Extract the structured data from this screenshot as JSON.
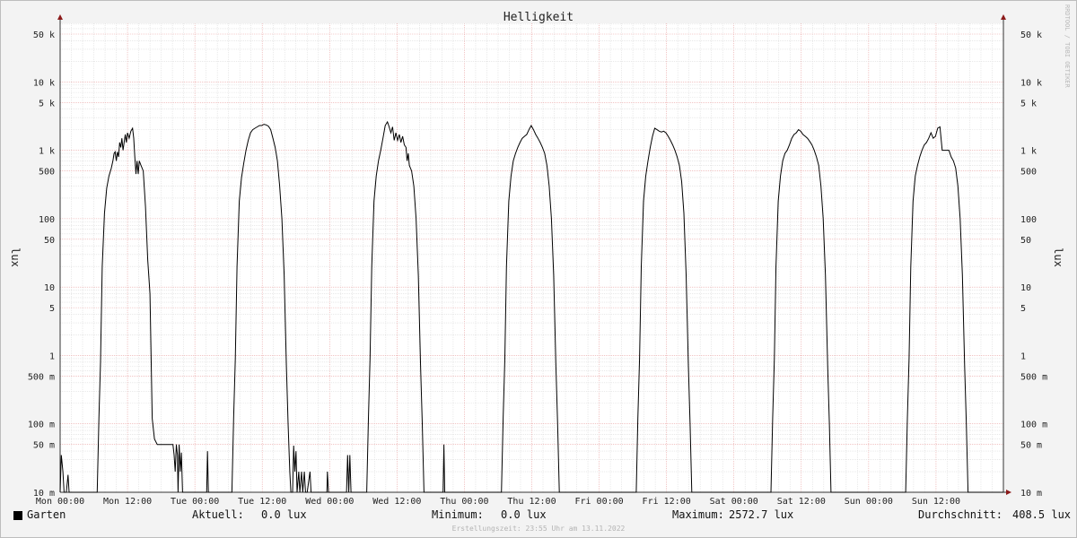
{
  "chart_data": {
    "type": "line",
    "title": "Helligkeit",
    "ylabel": "lux",
    "yscale": "log",
    "ylim": [
      10,
      70000
    ],
    "y_ticks": [
      {
        "value": 10,
        "label": "10 m",
        "unit": 0.001
      },
      {
        "value": 50,
        "label": "50 m",
        "unit": 0.001
      },
      {
        "value": 100,
        "label": "100 m",
        "unit": 0.001
      },
      {
        "value": 500,
        "label": "500 m",
        "unit": 0.001
      },
      {
        "value": 1000,
        "label": "1"
      },
      {
        "value": 5000,
        "label": "5"
      },
      {
        "value": 10000,
        "label": "10"
      },
      {
        "value": 50000,
        "label": "50"
      },
      {
        "value": 100000,
        "label": "100"
      },
      {
        "value": 500000,
        "label": "500"
      },
      {
        "value": 1000000,
        "label": "1 k"
      },
      {
        "value": 5000000,
        "label": "5 k"
      },
      {
        "value": 10000000,
        "label": "10 k"
      },
      {
        "value": 50000000,
        "label": "50 k"
      }
    ],
    "x_unit": "hours",
    "xlim": [
      0,
      168
    ],
    "x_ticks": [
      {
        "value": 0,
        "label": "Mon 00:00"
      },
      {
        "value": 12,
        "label": "Mon 12:00"
      },
      {
        "value": 24,
        "label": "Tue 00:00"
      },
      {
        "value": 36,
        "label": "Tue 12:00"
      },
      {
        "value": 48,
        "label": "Wed 00:00"
      },
      {
        "value": 60,
        "label": "Wed 12:00"
      },
      {
        "value": 72,
        "label": "Thu 00:00"
      },
      {
        "value": 84,
        "label": "Thu 12:00"
      },
      {
        "value": 96,
        "label": "Fri 00:00"
      },
      {
        "value": 108,
        "label": "Fri 12:00"
      },
      {
        "value": 120,
        "label": "Sat 00:00"
      },
      {
        "value": 132,
        "label": "Sat 12:00"
      },
      {
        "value": 144,
        "label": "Sun 00:00"
      },
      {
        "value": 156,
        "label": "Sun 12:00"
      }
    ],
    "grid": true,
    "series": [
      {
        "name": "Garten",
        "color": "#000000",
        "points": [
          [
            0,
            0.01
          ],
          [
            0.2,
            0.035
          ],
          [
            0.5,
            0.02
          ],
          [
            0.7,
            0.01
          ],
          [
            1.1,
            0.01
          ],
          [
            1.4,
            0.018
          ],
          [
            1.6,
            0.01
          ],
          [
            6.6,
            0.01
          ],
          [
            6.9,
            0.12
          ],
          [
            7.2,
            0.8
          ],
          [
            7.5,
            20
          ],
          [
            7.9,
            120
          ],
          [
            8.3,
            280
          ],
          [
            8.7,
            420
          ],
          [
            9.1,
            540
          ],
          [
            9.4,
            700
          ],
          [
            9.6,
            900
          ],
          [
            9.8,
            950
          ],
          [
            10,
            700
          ],
          [
            10.2,
            950
          ],
          [
            10.4,
            800
          ],
          [
            10.6,
            1300
          ],
          [
            10.8,
            1100
          ],
          [
            11,
            1500
          ],
          [
            11.2,
            1000
          ],
          [
            11.4,
            1300
          ],
          [
            11.6,
            1700
          ],
          [
            11.8,
            1300
          ],
          [
            12,
            1800
          ],
          [
            12.3,
            1500
          ],
          [
            12.6,
            1900
          ],
          [
            12.9,
            2100
          ],
          [
            13.1,
            1500
          ],
          [
            13.3,
            800
          ],
          [
            13.5,
            450
          ],
          [
            13.7,
            700
          ],
          [
            13.9,
            450
          ],
          [
            14.1,
            700
          ],
          [
            14.4,
            600
          ],
          [
            14.8,
            500
          ],
          [
            15.2,
            150
          ],
          [
            15.6,
            25
          ],
          [
            16,
            8
          ],
          [
            16.4,
            0.12
          ],
          [
            16.8,
            0.06
          ],
          [
            17.3,
            0.05
          ],
          [
            18,
            0.05
          ],
          [
            19.5,
            0.05
          ],
          [
            20.1,
            0.05
          ],
          [
            20.3,
            0.035
          ],
          [
            20.5,
            0.02
          ],
          [
            20.7,
            0.05
          ],
          [
            20.9,
            0.035
          ],
          [
            21,
            0.01
          ],
          [
            21.2,
            0.05
          ],
          [
            21.4,
            0.02
          ],
          [
            21.6,
            0.038
          ],
          [
            21.8,
            0.01
          ],
          [
            22,
            0.01
          ],
          [
            23,
            0.01
          ],
          [
            26.1,
            0.01
          ],
          [
            26.25,
            0.04
          ],
          [
            26.4,
            0.01
          ],
          [
            30.6,
            0.01
          ],
          [
            30.9,
            0.12
          ],
          [
            31.2,
            0.9
          ],
          [
            31.5,
            20
          ],
          [
            31.9,
            180
          ],
          [
            32.3,
            400
          ],
          [
            32.7,
            650
          ],
          [
            33.1,
            1000
          ],
          [
            33.5,
            1400
          ],
          [
            33.9,
            1800
          ],
          [
            34.3,
            2000
          ],
          [
            34.7,
            2100
          ],
          [
            35.1,
            2200
          ],
          [
            35.5,
            2300
          ],
          [
            35.9,
            2300
          ],
          [
            36.3,
            2400
          ],
          [
            36.7,
            2350
          ],
          [
            37.1,
            2250
          ],
          [
            37.5,
            2000
          ],
          [
            37.9,
            1500
          ],
          [
            38.3,
            1100
          ],
          [
            38.7,
            700
          ],
          [
            39.1,
            300
          ],
          [
            39.5,
            100
          ],
          [
            39.9,
            15
          ],
          [
            40.3,
            0.7
          ],
          [
            40.6,
            0.1
          ],
          [
            40.9,
            0.02
          ],
          [
            41.1,
            0.01
          ],
          [
            41.4,
            0.01
          ],
          [
            41.6,
            0.048
          ],
          [
            41.8,
            0.02
          ],
          [
            42,
            0.04
          ],
          [
            42.2,
            0.01
          ],
          [
            42.5,
            0.02
          ],
          [
            42.7,
            0.01
          ],
          [
            43,
            0.02
          ],
          [
            43.2,
            0.01
          ],
          [
            43.5,
            0.02
          ],
          [
            43.7,
            0.01
          ],
          [
            44,
            0.01
          ],
          [
            44.5,
            0.02
          ],
          [
            44.7,
            0.01
          ],
          [
            45,
            0.01
          ],
          [
            47.5,
            0.01
          ],
          [
            47.6,
            0.02
          ],
          [
            47.8,
            0.01
          ],
          [
            51,
            0.01
          ],
          [
            51.2,
            0.035
          ],
          [
            51.4,
            0.01
          ],
          [
            51.6,
            0.035
          ],
          [
            51.8,
            0.01
          ],
          [
            54.6,
            0.01
          ],
          [
            54.9,
            0.12
          ],
          [
            55.2,
            0.9
          ],
          [
            55.5,
            20
          ],
          [
            55.9,
            180
          ],
          [
            56.3,
            420
          ],
          [
            56.7,
            700
          ],
          [
            57.1,
            1000
          ],
          [
            57.5,
            1500
          ],
          [
            57.9,
            2300
          ],
          [
            58.3,
            2600
          ],
          [
            58.6,
            2200
          ],
          [
            58.9,
            1800
          ],
          [
            59.2,
            2200
          ],
          [
            59.5,
            1400
          ],
          [
            59.8,
            1800
          ],
          [
            60.1,
            1400
          ],
          [
            60.4,
            1700
          ],
          [
            60.7,
            1300
          ],
          [
            61,
            1600
          ],
          [
            61.3,
            1200
          ],
          [
            61.6,
            1100
          ],
          [
            61.8,
            700
          ],
          [
            62,
            900
          ],
          [
            62.2,
            600
          ],
          [
            62.6,
            500
          ],
          [
            63,
            300
          ],
          [
            63.4,
            100
          ],
          [
            63.8,
            15
          ],
          [
            64.2,
            0.7
          ],
          [
            64.5,
            0.1
          ],
          [
            64.8,
            0.01
          ],
          [
            65.5,
            0.01
          ],
          [
            68.2,
            0.01
          ],
          [
            68.35,
            0.05
          ],
          [
            68.5,
            0.01
          ],
          [
            78.6,
            0.01
          ],
          [
            78.9,
            0.12
          ],
          [
            79.2,
            0.9
          ],
          [
            79.5,
            20
          ],
          [
            79.9,
            180
          ],
          [
            80.3,
            420
          ],
          [
            80.7,
            700
          ],
          [
            81.1,
            900
          ],
          [
            81.5,
            1100
          ],
          [
            81.9,
            1300
          ],
          [
            82.3,
            1500
          ],
          [
            82.7,
            1600
          ],
          [
            83.1,
            1700
          ],
          [
            83.5,
            2000
          ],
          [
            83.9,
            2300
          ],
          [
            84.3,
            2000
          ],
          [
            84.7,
            1700
          ],
          [
            85.1,
            1500
          ],
          [
            85.5,
            1300
          ],
          [
            85.9,
            1100
          ],
          [
            86.3,
            900
          ],
          [
            86.7,
            600
          ],
          [
            87.1,
            300
          ],
          [
            87.5,
            100
          ],
          [
            87.9,
            15
          ],
          [
            88.3,
            0.7
          ],
          [
            88.6,
            0.1
          ],
          [
            88.9,
            0.01
          ],
          [
            90,
            0.01
          ],
          [
            102.6,
            0.01
          ],
          [
            102.9,
            0.12
          ],
          [
            103.2,
            0.9
          ],
          [
            103.5,
            20
          ],
          [
            103.9,
            180
          ],
          [
            104.3,
            420
          ],
          [
            104.7,
            700
          ],
          [
            105.1,
            1100
          ],
          [
            105.5,
            1600
          ],
          [
            105.9,
            2100
          ],
          [
            106.3,
            2000
          ],
          [
            106.7,
            1900
          ],
          [
            107.1,
            1850
          ],
          [
            107.5,
            1900
          ],
          [
            107.9,
            1800
          ],
          [
            108.3,
            1600
          ],
          [
            108.7,
            1400
          ],
          [
            109.1,
            1200
          ],
          [
            109.5,
            1000
          ],
          [
            109.9,
            800
          ],
          [
            110.3,
            600
          ],
          [
            110.7,
            350
          ],
          [
            111.1,
            120
          ],
          [
            111.5,
            15
          ],
          [
            111.9,
            0.7
          ],
          [
            112.2,
            0.1
          ],
          [
            112.5,
            0.01
          ],
          [
            114,
            0.01
          ],
          [
            126.6,
            0.01
          ],
          [
            126.9,
            0.12
          ],
          [
            127.2,
            0.9
          ],
          [
            127.5,
            20
          ],
          [
            127.9,
            180
          ],
          [
            128.3,
            420
          ],
          [
            128.7,
            700
          ],
          [
            129.1,
            900
          ],
          [
            129.5,
            1000
          ],
          [
            129.9,
            1200
          ],
          [
            130.3,
            1500
          ],
          [
            130.7,
            1700
          ],
          [
            131.1,
            1800
          ],
          [
            131.5,
            2000
          ],
          [
            131.9,
            1900
          ],
          [
            132.3,
            1700
          ],
          [
            132.7,
            1600
          ],
          [
            133.1,
            1500
          ],
          [
            133.5,
            1350
          ],
          [
            133.9,
            1200
          ],
          [
            134.3,
            1000
          ],
          [
            134.7,
            800
          ],
          [
            135.1,
            600
          ],
          [
            135.5,
            300
          ],
          [
            135.9,
            100
          ],
          [
            136.3,
            15
          ],
          [
            136.7,
            0.7
          ],
          [
            137,
            0.1
          ],
          [
            137.3,
            0.01
          ],
          [
            138,
            0.01
          ],
          [
            150.6,
            0.01
          ],
          [
            150.9,
            0.12
          ],
          [
            151.2,
            0.9
          ],
          [
            151.5,
            20
          ],
          [
            151.9,
            180
          ],
          [
            152.3,
            420
          ],
          [
            152.7,
            600
          ],
          [
            153.1,
            800
          ],
          [
            153.5,
            1000
          ],
          [
            153.9,
            1200
          ],
          [
            154.3,
            1300
          ],
          [
            154.7,
            1500
          ],
          [
            155.1,
            1800
          ],
          [
            155.5,
            1500
          ],
          [
            155.9,
            1600
          ],
          [
            156.3,
            2100
          ],
          [
            156.7,
            2200
          ],
          [
            157.1,
            1000
          ],
          [
            157.5,
            1000
          ],
          [
            157.9,
            1000
          ],
          [
            158.3,
            1000
          ],
          [
            158.7,
            800
          ],
          [
            159.1,
            700
          ],
          [
            159.5,
            550
          ],
          [
            159.9,
            300
          ],
          [
            160.3,
            100
          ],
          [
            160.7,
            15
          ],
          [
            161.1,
            0.7
          ],
          [
            161.4,
            0.1
          ],
          [
            161.7,
            0.01
          ],
          [
            168,
            0.01
          ]
        ]
      }
    ]
  },
  "legend": {
    "series_name": "Garten",
    "aktuell_label": "Aktuell:",
    "aktuell_value": "0.0 lux",
    "minimum_label": "Minimum:",
    "minimum_value": "0.0 lux",
    "maximum_label": "Maximum:",
    "maximum_value": "2572.7 lux",
    "average_label": "Durchschnitt:",
    "average_value": "408.5 lux"
  },
  "footer": "Erstellungszeit: 23:55 Uhr am 13.11.2022",
  "watermark": "RRDTOOL / TOBI OETIKER",
  "colors": {
    "background": "#f3f3f3",
    "plot_background": "#ffffff",
    "minor_grid": "#dcdcdc",
    "major_grid": "#e9a0a0",
    "axis_arrow": "#8b1a1a",
    "line": "#000000"
  }
}
